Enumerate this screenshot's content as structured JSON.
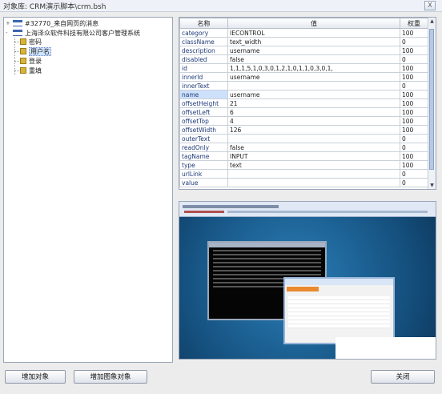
{
  "window": {
    "title": "对象库: CRM演示脚本\\crm.bsh",
    "close_glyph": "X"
  },
  "tree": {
    "nodes": [
      {
        "label": "#32770_来自网页的消息",
        "expander": "+"
      },
      {
        "label": "上海泽众软件科技有限公司客户管理系统",
        "expander": "-"
      }
    ],
    "children": [
      {
        "label": "密码"
      },
      {
        "label": "用户名",
        "selected": true
      },
      {
        "label": "登录"
      },
      {
        "label": "重填"
      }
    ]
  },
  "properties": {
    "headers": [
      "名称",
      "值",
      "权重"
    ],
    "rows": [
      [
        "category",
        "IECONTROL",
        "100"
      ],
      [
        "className",
        "text_width",
        "0"
      ],
      [
        "description",
        "username",
        "100"
      ],
      [
        "disabled",
        "false",
        "0"
      ],
      [
        "id",
        "1,1,1,5,1,0,3,0,1,2,1,0,1,1,0,3,0,1,",
        "100"
      ],
      [
        "innerId",
        "username",
        "100"
      ],
      [
        "innerText",
        "",
        "0"
      ],
      [
        "name",
        "username",
        "100"
      ],
      [
        "offsetHeight",
        "21",
        "100"
      ],
      [
        "offsetLeft",
        "6",
        "100"
      ],
      [
        "offsetTop",
        "4",
        "100"
      ],
      [
        "offsetWidth",
        "126",
        "100"
      ],
      [
        "outerText",
        "",
        "0"
      ],
      [
        "readOnly",
        "false",
        "0"
      ],
      [
        "tagName",
        "INPUT",
        "100"
      ],
      [
        "type",
        "text",
        "100"
      ],
      [
        "urlLink",
        "",
        "0"
      ],
      [
        "value",
        "",
        "0"
      ]
    ],
    "selected_row": 7
  },
  "buttons": {
    "add_object": "增加对象",
    "add_image_object": "增加图象对象",
    "close": "关闭"
  }
}
